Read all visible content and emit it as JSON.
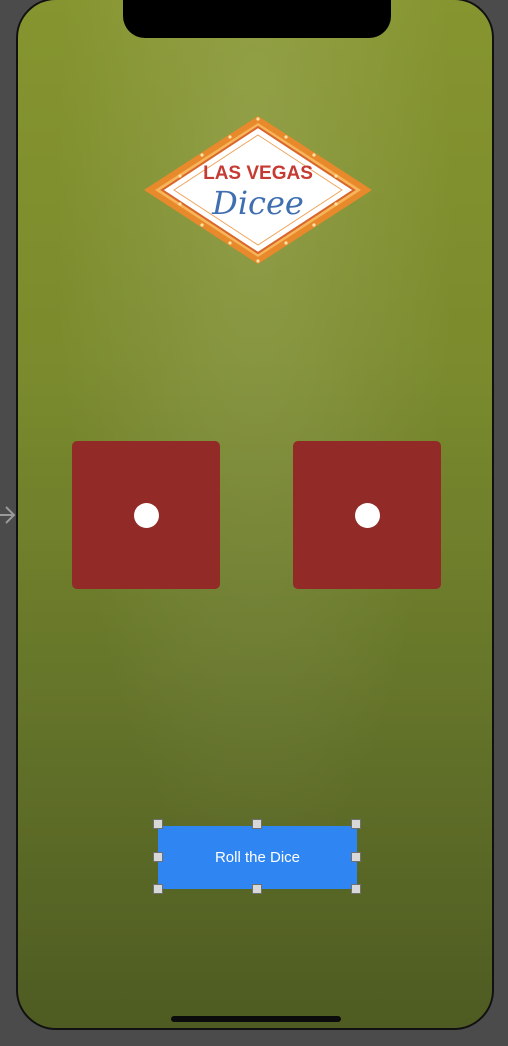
{
  "logo": {
    "line1": "LAS VEGAS",
    "line2": "Dicee"
  },
  "dice": [
    {
      "value": 1
    },
    {
      "value": 1
    }
  ],
  "roll_button": {
    "label": "Roll the Dice"
  },
  "colors": {
    "background": "#7b8b2d",
    "die": "#922b27",
    "pip": "#ffffff",
    "button": "#2f86f2",
    "logo_red": "#c53a33",
    "logo_blue": "#3f6fb0",
    "logo_orange": "#e8892b"
  }
}
